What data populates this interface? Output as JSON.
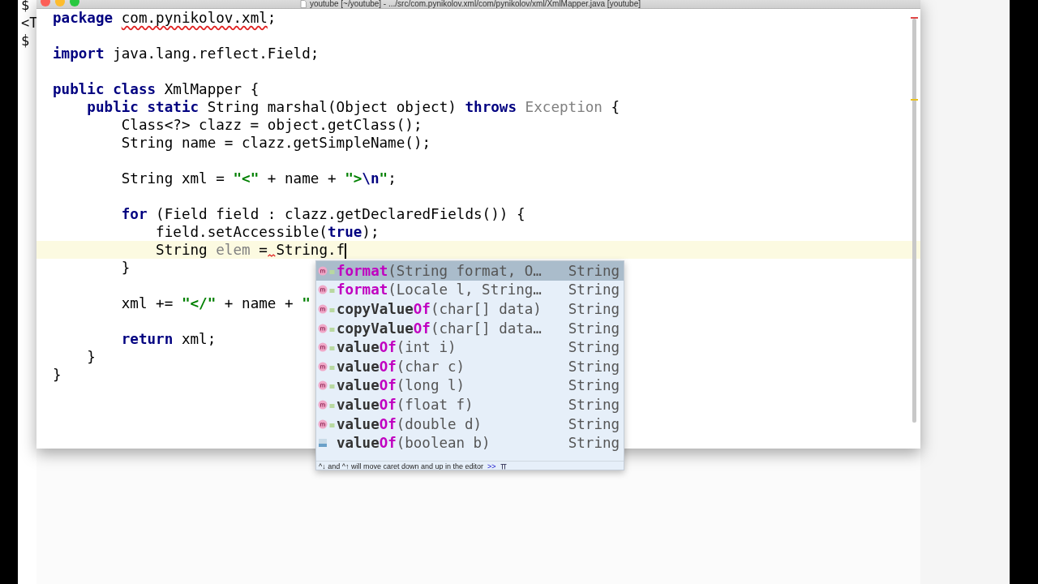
{
  "terminal": {
    "lines": [
      "$",
      "<T",
      "$"
    ]
  },
  "window": {
    "title": "youtube [~/youtube] - .../src/com.pynikolov.xml/com/pynikolov/xml/XmlMapper.java [youtube]"
  },
  "editor": {
    "lines": [
      {
        "current": false,
        "tokens": [
          {
            "text": "package ",
            "kind": "keyword"
          },
          {
            "text": "com.pynikolov.xml",
            "kind": "error"
          },
          {
            "text": ";",
            "kind": "plain"
          }
        ]
      },
      {
        "current": false
      },
      {
        "current": false,
        "tokens": [
          {
            "text": "import ",
            "kind": "keyword"
          },
          {
            "text": "java.lang.reflect.Field;",
            "kind": "plain"
          }
        ]
      },
      {
        "current": false
      },
      {
        "current": false,
        "tokens": [
          {
            "text": "public class ",
            "kind": "keyword"
          },
          {
            "text": "XmlMapper {",
            "kind": "plain"
          }
        ]
      },
      {
        "current": false,
        "tokens": [
          {
            "text": "    public static ",
            "kind": "keyword"
          },
          {
            "text": "String marshal(Object object) ",
            "kind": "plain"
          },
          {
            "text": "throws ",
            "kind": "keyword"
          },
          {
            "text": "Exception",
            "kind": "unused"
          },
          {
            "text": " {",
            "kind": "plain"
          }
        ]
      },
      {
        "current": false,
        "tokens": [
          {
            "text": "        Class<?> clazz = object.getClass();",
            "kind": "plain"
          }
        ]
      },
      {
        "current": false,
        "tokens": [
          {
            "text": "        String name = clazz.getSimpleName();",
            "kind": "plain"
          }
        ]
      },
      {
        "current": false
      },
      {
        "current": false,
        "tokens": [
          {
            "text": "        String xml = ",
            "kind": "plain"
          },
          {
            "text": "\"<\"",
            "kind": "string"
          },
          {
            "text": " + name + ",
            "kind": "plain"
          },
          {
            "text": "\">",
            "kind": "string"
          },
          {
            "text": "\\n",
            "kind": "escape"
          },
          {
            "text": "\"",
            "kind": "string"
          },
          {
            "text": ";",
            "kind": "plain"
          }
        ]
      },
      {
        "current": false
      },
      {
        "current": false,
        "tokens": [
          {
            "text": "        for ",
            "kind": "keyword"
          },
          {
            "text": "(Field field : clazz.getDeclaredFields()) {",
            "kind": "plain"
          }
        ]
      },
      {
        "current": false,
        "tokens": [
          {
            "text": "            field.setAccessible(",
            "kind": "plain"
          },
          {
            "text": "true",
            "kind": "keyword"
          },
          {
            "text": ");",
            "kind": "plain"
          }
        ]
      },
      {
        "current": true,
        "tokens": [
          {
            "text": "            String ",
            "kind": "plain"
          },
          {
            "text": "elem",
            "kind": "unused"
          },
          {
            "text": " =",
            "kind": "plain"
          },
          {
            "kind": "error_gap"
          },
          {
            "text": "String.f",
            "kind": "plain"
          }
        ]
      },
      {
        "current": false,
        "tokens": [
          {
            "text": "        }",
            "kind": "plain"
          }
        ]
      },
      {
        "current": false
      },
      {
        "current": false,
        "tokens": [
          {
            "text": "        xml += ",
            "kind": "plain"
          },
          {
            "text": "\"</\"",
            "kind": "string"
          },
          {
            "text": " + name + ",
            "kind": "plain"
          },
          {
            "text": "\"",
            "kind": "string"
          }
        ]
      },
      {
        "current": false
      },
      {
        "current": false,
        "tokens": [
          {
            "text": "        return ",
            "kind": "keyword"
          },
          {
            "text": "xml;",
            "kind": "plain"
          }
        ]
      },
      {
        "current": false,
        "tokens": [
          {
            "text": "    }",
            "kind": "plain"
          }
        ]
      },
      {
        "current": false,
        "tokens": [
          {
            "text": "}",
            "kind": "plain"
          }
        ]
      }
    ]
  },
  "completion": {
    "items": [
      {
        "kind": "method",
        "selected": true,
        "name": [
          {
            "text": "format",
            "match": true
          }
        ],
        "params": "(String format, O…",
        "type": "String"
      },
      {
        "kind": "method",
        "selected": false,
        "name": [
          {
            "text": "format",
            "match": true
          }
        ],
        "params": "(Locale l, String…",
        "type": "String"
      },
      {
        "kind": "method",
        "selected": false,
        "name": [
          {
            "text": "copyValue",
            "match": false
          },
          {
            "text": "Of",
            "match": true
          }
        ],
        "params": "(char[] data)",
        "type": "String"
      },
      {
        "kind": "method",
        "selected": false,
        "name": [
          {
            "text": "copyValue",
            "match": false
          },
          {
            "text": "Of",
            "match": true
          }
        ],
        "params": "(char[] data…",
        "type": "String"
      },
      {
        "kind": "method",
        "selected": false,
        "name": [
          {
            "text": "value",
            "match": false
          },
          {
            "text": "Of",
            "match": true
          }
        ],
        "params": "(int i)",
        "type": "String"
      },
      {
        "kind": "method",
        "selected": false,
        "name": [
          {
            "text": "value",
            "match": false
          },
          {
            "text": "Of",
            "match": true
          }
        ],
        "params": "(char c)",
        "type": "String"
      },
      {
        "kind": "method",
        "selected": false,
        "name": [
          {
            "text": "value",
            "match": false
          },
          {
            "text": "Of",
            "match": true
          }
        ],
        "params": "(long l)",
        "type": "String"
      },
      {
        "kind": "method",
        "selected": false,
        "name": [
          {
            "text": "value",
            "match": false
          },
          {
            "text": "Of",
            "match": true
          }
        ],
        "params": "(float f)",
        "type": "String"
      },
      {
        "kind": "method",
        "selected": false,
        "name": [
          {
            "text": "value",
            "match": false
          },
          {
            "text": "Of",
            "match": true
          }
        ],
        "params": "(double d)",
        "type": "String"
      },
      {
        "kind": "binary",
        "selected": false,
        "name": [
          {
            "text": "value",
            "match": false
          },
          {
            "text": "Of",
            "match": true
          }
        ],
        "params": "(boolean b)",
        "type": "String"
      }
    ],
    "hint": "^↓ and ^↑ will move caret down and up in the editor",
    "hint_link": ">>"
  }
}
